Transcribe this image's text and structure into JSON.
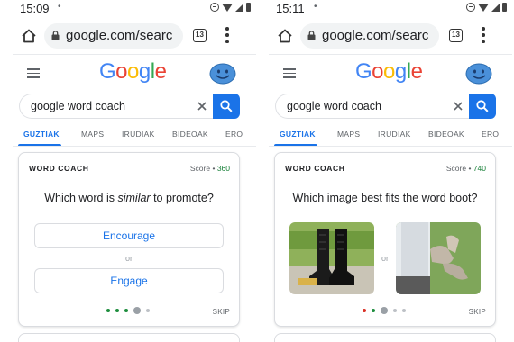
{
  "left": {
    "status": {
      "time": "15:09",
      "dot": "•"
    },
    "url": "google.com/searc",
    "tab_count": "13",
    "logo": [
      "G",
      "o",
      "o",
      "g",
      "l",
      "e"
    ],
    "search_query": "google word coach",
    "tabs": [
      "GUZTIAK",
      "MAPS",
      "IRUDIAK",
      "BIDEOAK",
      "ERO"
    ],
    "card": {
      "title": "WORD COACH",
      "score_label": "Score •",
      "score_value": "360",
      "question_pre": "Which word is ",
      "question_em": "similar",
      "question_post": " to promote?",
      "option_1": "Encourage",
      "or": "or",
      "option_2": "Engage",
      "skip": "SKIP"
    }
  },
  "right": {
    "status": {
      "time": "15:11",
      "dot": "•"
    },
    "url": "google.com/searc",
    "tab_count": "13",
    "logo": [
      "G",
      "o",
      "o",
      "g",
      "l",
      "e"
    ],
    "search_query": "google word coach",
    "tabs": [
      "GUZTIAK",
      "MAPS",
      "IRUDIAK",
      "BIDEOAK",
      "ERO"
    ],
    "card": {
      "title": "WORD COACH",
      "score_label": "Score •",
      "score_value": "740",
      "question": "Which image best fits the word boot?",
      "or": "or",
      "skip": "SKIP"
    }
  },
  "colors": {
    "accent": "#1a73e8",
    "score_green": "#188038",
    "dot_green": "#1e8e3e",
    "dot_red": "#d93025",
    "dot_grey": "#9aa0a6",
    "logo": [
      "#4285f4",
      "#ea4335",
      "#fbbc05",
      "#4285f4",
      "#34a853",
      "#ea4335"
    ]
  },
  "icons": [
    "home-icon",
    "lock-icon",
    "tabs-icon",
    "menu-icon",
    "hamburger-icon",
    "avatar-icon",
    "clear-icon",
    "search-icon"
  ]
}
